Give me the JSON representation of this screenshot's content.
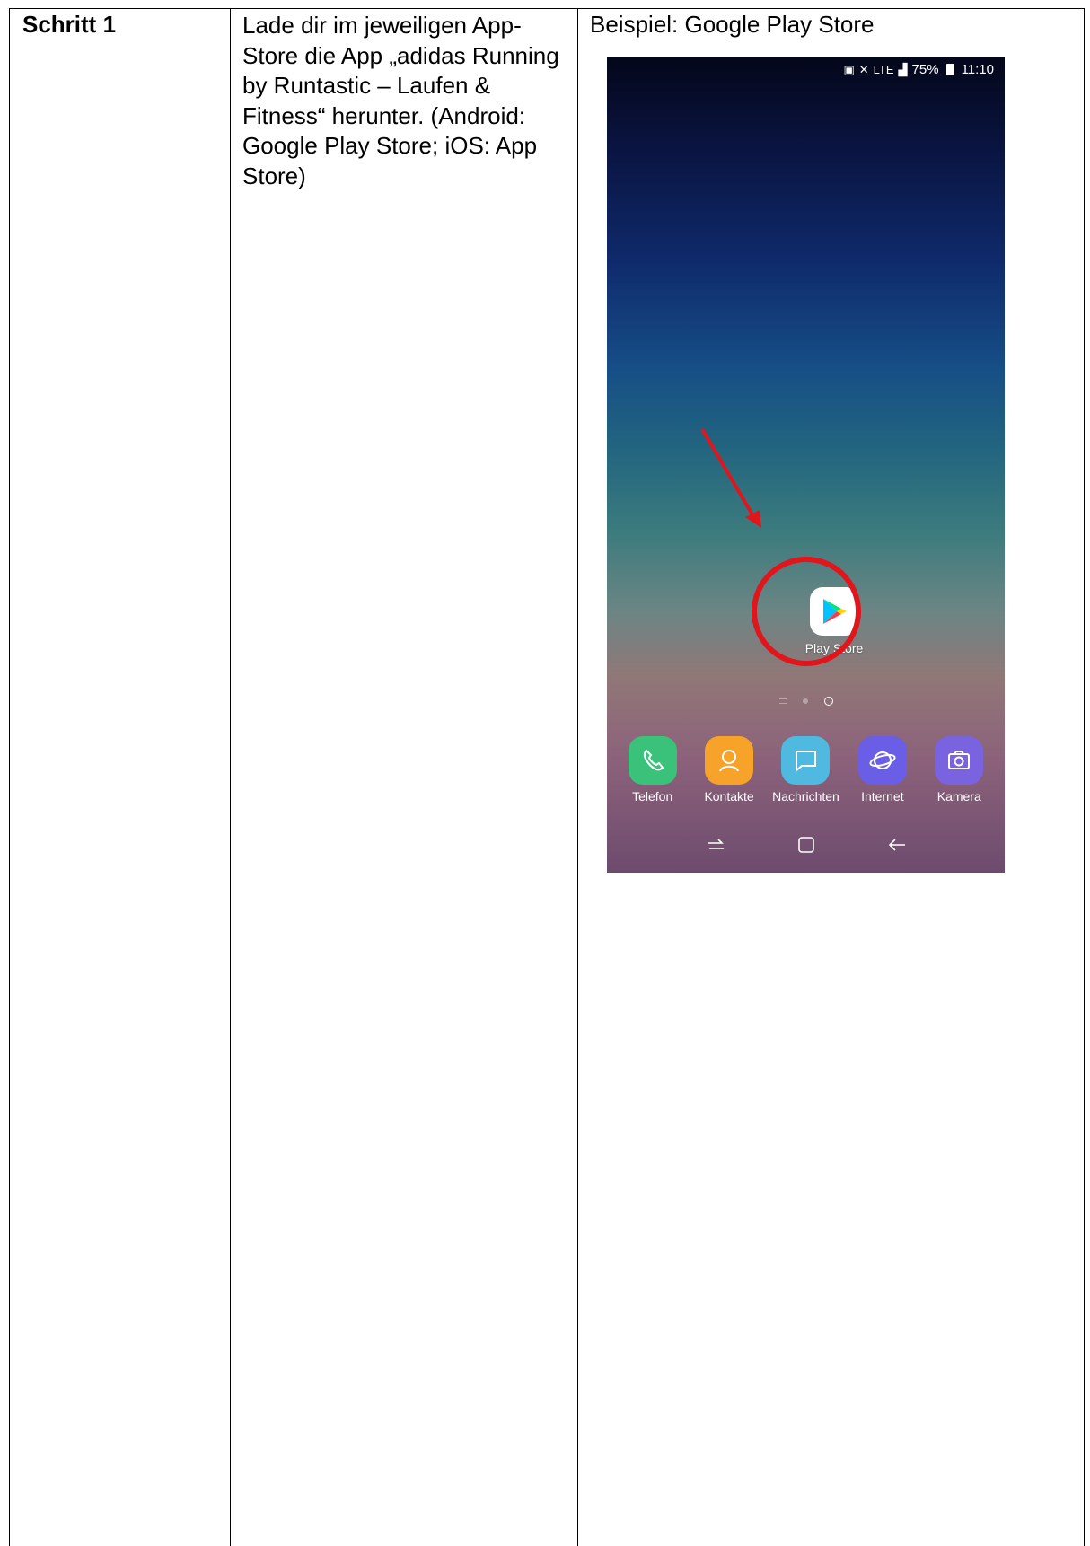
{
  "table": {
    "step_label": "Schritt 1",
    "step_text": "Lade dir im jeweiligen App-Store die App „adidas Running by Runtastic – Laufen & Fitness“ herunter. (Android: Google Play Store; iOS: App Store)",
    "example_title": "Beispiel: Google Play Store"
  },
  "phone": {
    "status": {
      "network": "LTE",
      "battery": "75%",
      "time": "11:10"
    },
    "highlighted_app": {
      "label": "Play Store",
      "icon": "play-store-icon"
    },
    "page_indicator": {
      "pages": 3,
      "active": 3
    },
    "dock": [
      {
        "label": "Telefon",
        "icon": "phone-icon",
        "color": "#3ac27b"
      },
      {
        "label": "Kontakte",
        "icon": "contacts-icon",
        "color": "#f7a229"
      },
      {
        "label": "Nachrichten",
        "icon": "messages-icon",
        "color": "#4fb9e0"
      },
      {
        "label": "Internet",
        "icon": "internet-icon",
        "color": "#6a5ee6"
      },
      {
        "label": "Kamera",
        "icon": "camera-icon",
        "color": "#7a63de"
      }
    ],
    "nav": [
      {
        "icon": "recent-apps-icon"
      },
      {
        "icon": "home-icon"
      },
      {
        "icon": "back-icon"
      }
    ],
    "annotation_color": "#e1161c"
  }
}
